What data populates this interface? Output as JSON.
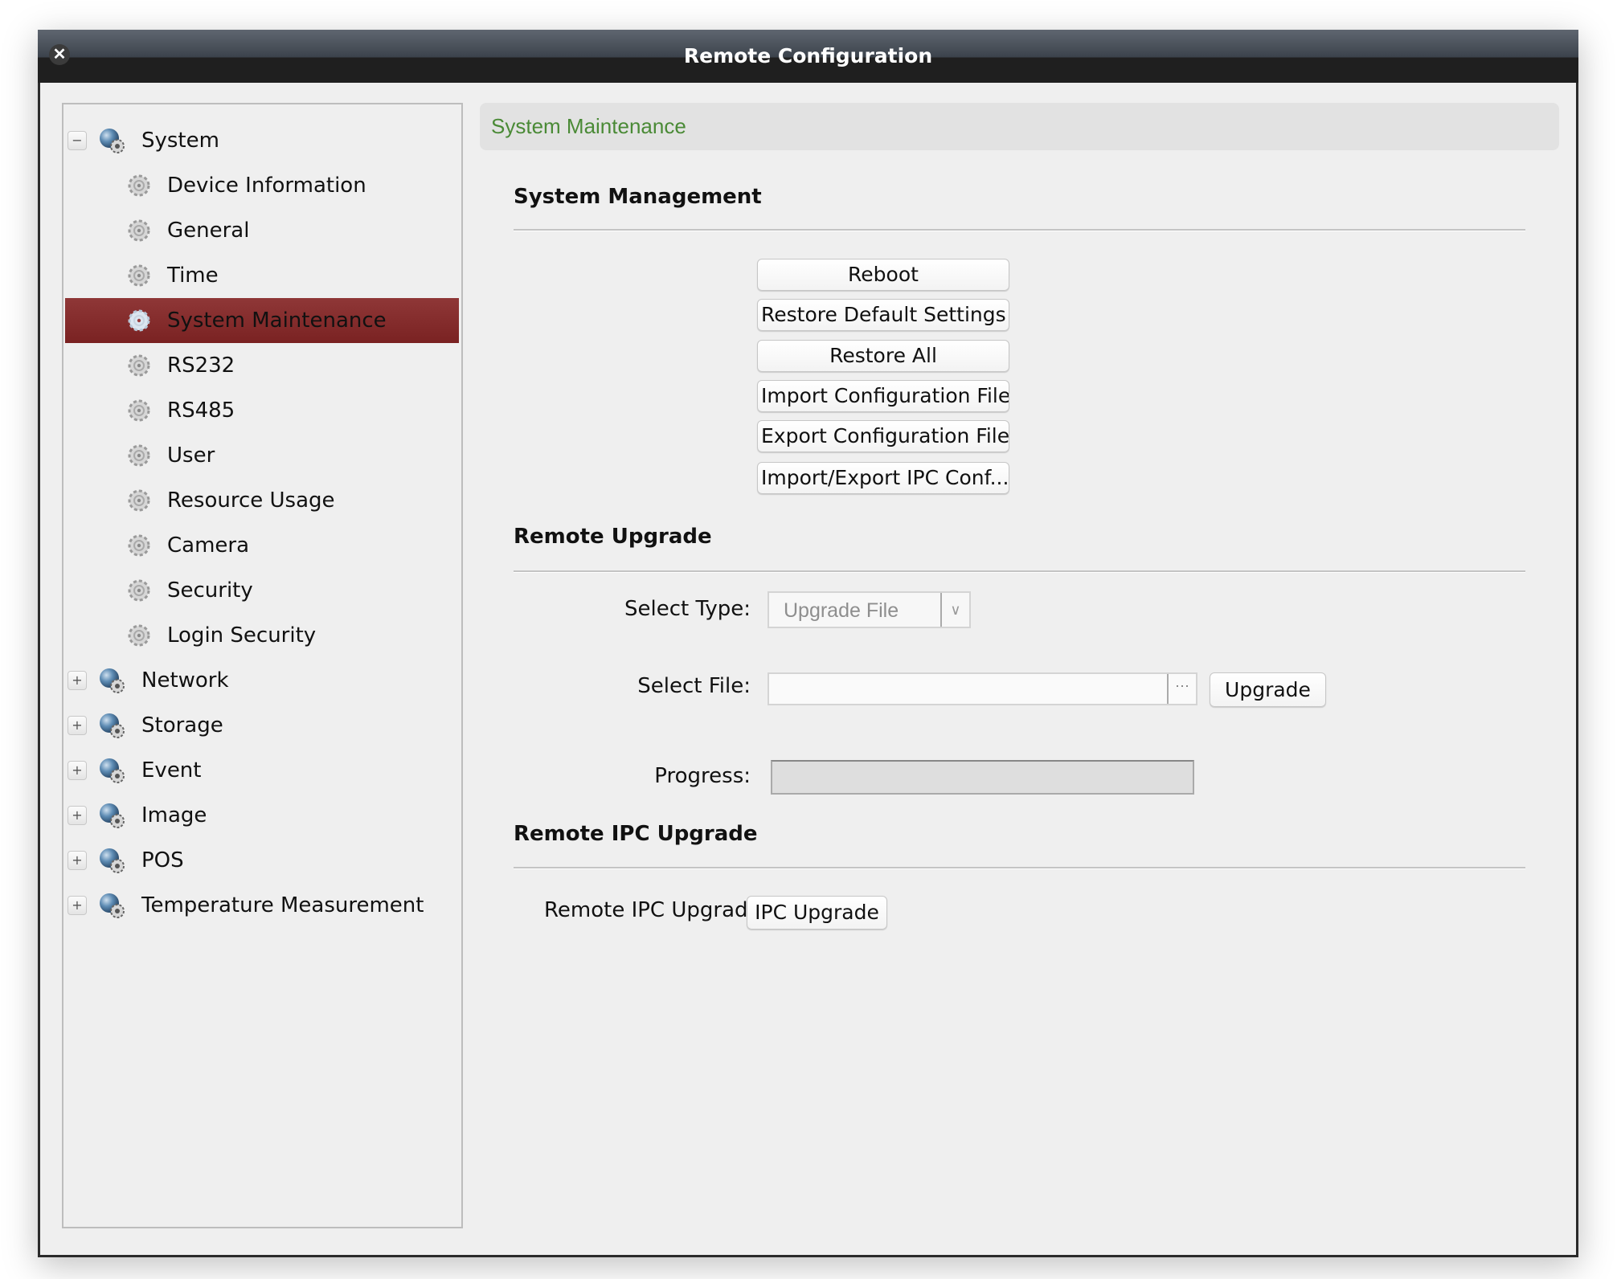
{
  "window": {
    "title": "Remote Configuration",
    "close_icon": "close-icon"
  },
  "sidebar": {
    "groups": [
      {
        "label": "System",
        "expanded": true,
        "expander": "−",
        "icon": "globe-gear-icon",
        "children": [
          {
            "label": "Device Information",
            "selected": false
          },
          {
            "label": "General",
            "selected": false
          },
          {
            "label": "Time",
            "selected": false
          },
          {
            "label": "System Maintenance",
            "selected": true
          },
          {
            "label": "RS232",
            "selected": false
          },
          {
            "label": "RS485",
            "selected": false
          },
          {
            "label": "User",
            "selected": false
          },
          {
            "label": "Resource Usage",
            "selected": false
          },
          {
            "label": "Camera",
            "selected": false
          },
          {
            "label": "Security",
            "selected": false
          },
          {
            "label": "Login Security",
            "selected": false
          }
        ]
      },
      {
        "label": "Network",
        "expanded": false,
        "expander": "+",
        "icon": "globe-gear-icon"
      },
      {
        "label": "Storage",
        "expanded": false,
        "expander": "+",
        "icon": "globe-gear-icon"
      },
      {
        "label": "Event",
        "expanded": false,
        "expander": "+",
        "icon": "globe-gear-icon"
      },
      {
        "label": "Image",
        "expanded": false,
        "expander": "+",
        "icon": "globe-gear-icon"
      },
      {
        "label": "POS",
        "expanded": false,
        "expander": "+",
        "icon": "globe-gear-icon"
      },
      {
        "label": "Temperature Measurement",
        "expanded": false,
        "expander": "+",
        "icon": "globe-gear-icon"
      }
    ]
  },
  "colors": {
    "header_title": "#4a8a36",
    "selected_row": "#852d2d",
    "titlebar": "#1f1f1f"
  },
  "main": {
    "header_title": "System Maintenance",
    "system_management": {
      "title": "System Management",
      "buttons": [
        "Reboot",
        "Restore Default Settings",
        "Restore All",
        "Import Configuration File",
        "Export Configuration File",
        "Import/Export IPC Conf..."
      ]
    },
    "remote_upgrade": {
      "title": "Remote Upgrade",
      "select_type_label": "Select Type:",
      "select_type_value": "Upgrade File",
      "select_file_label": "Select File:",
      "select_file_value": "",
      "browse_label": "···",
      "upgrade_button": "Upgrade",
      "progress_label": "Progress:",
      "progress_value": 0
    },
    "remote_ipc_upgrade": {
      "title": "Remote IPC Upgrade",
      "label": "Remote IPC Upgrade",
      "button": "IPC Upgrade"
    }
  }
}
